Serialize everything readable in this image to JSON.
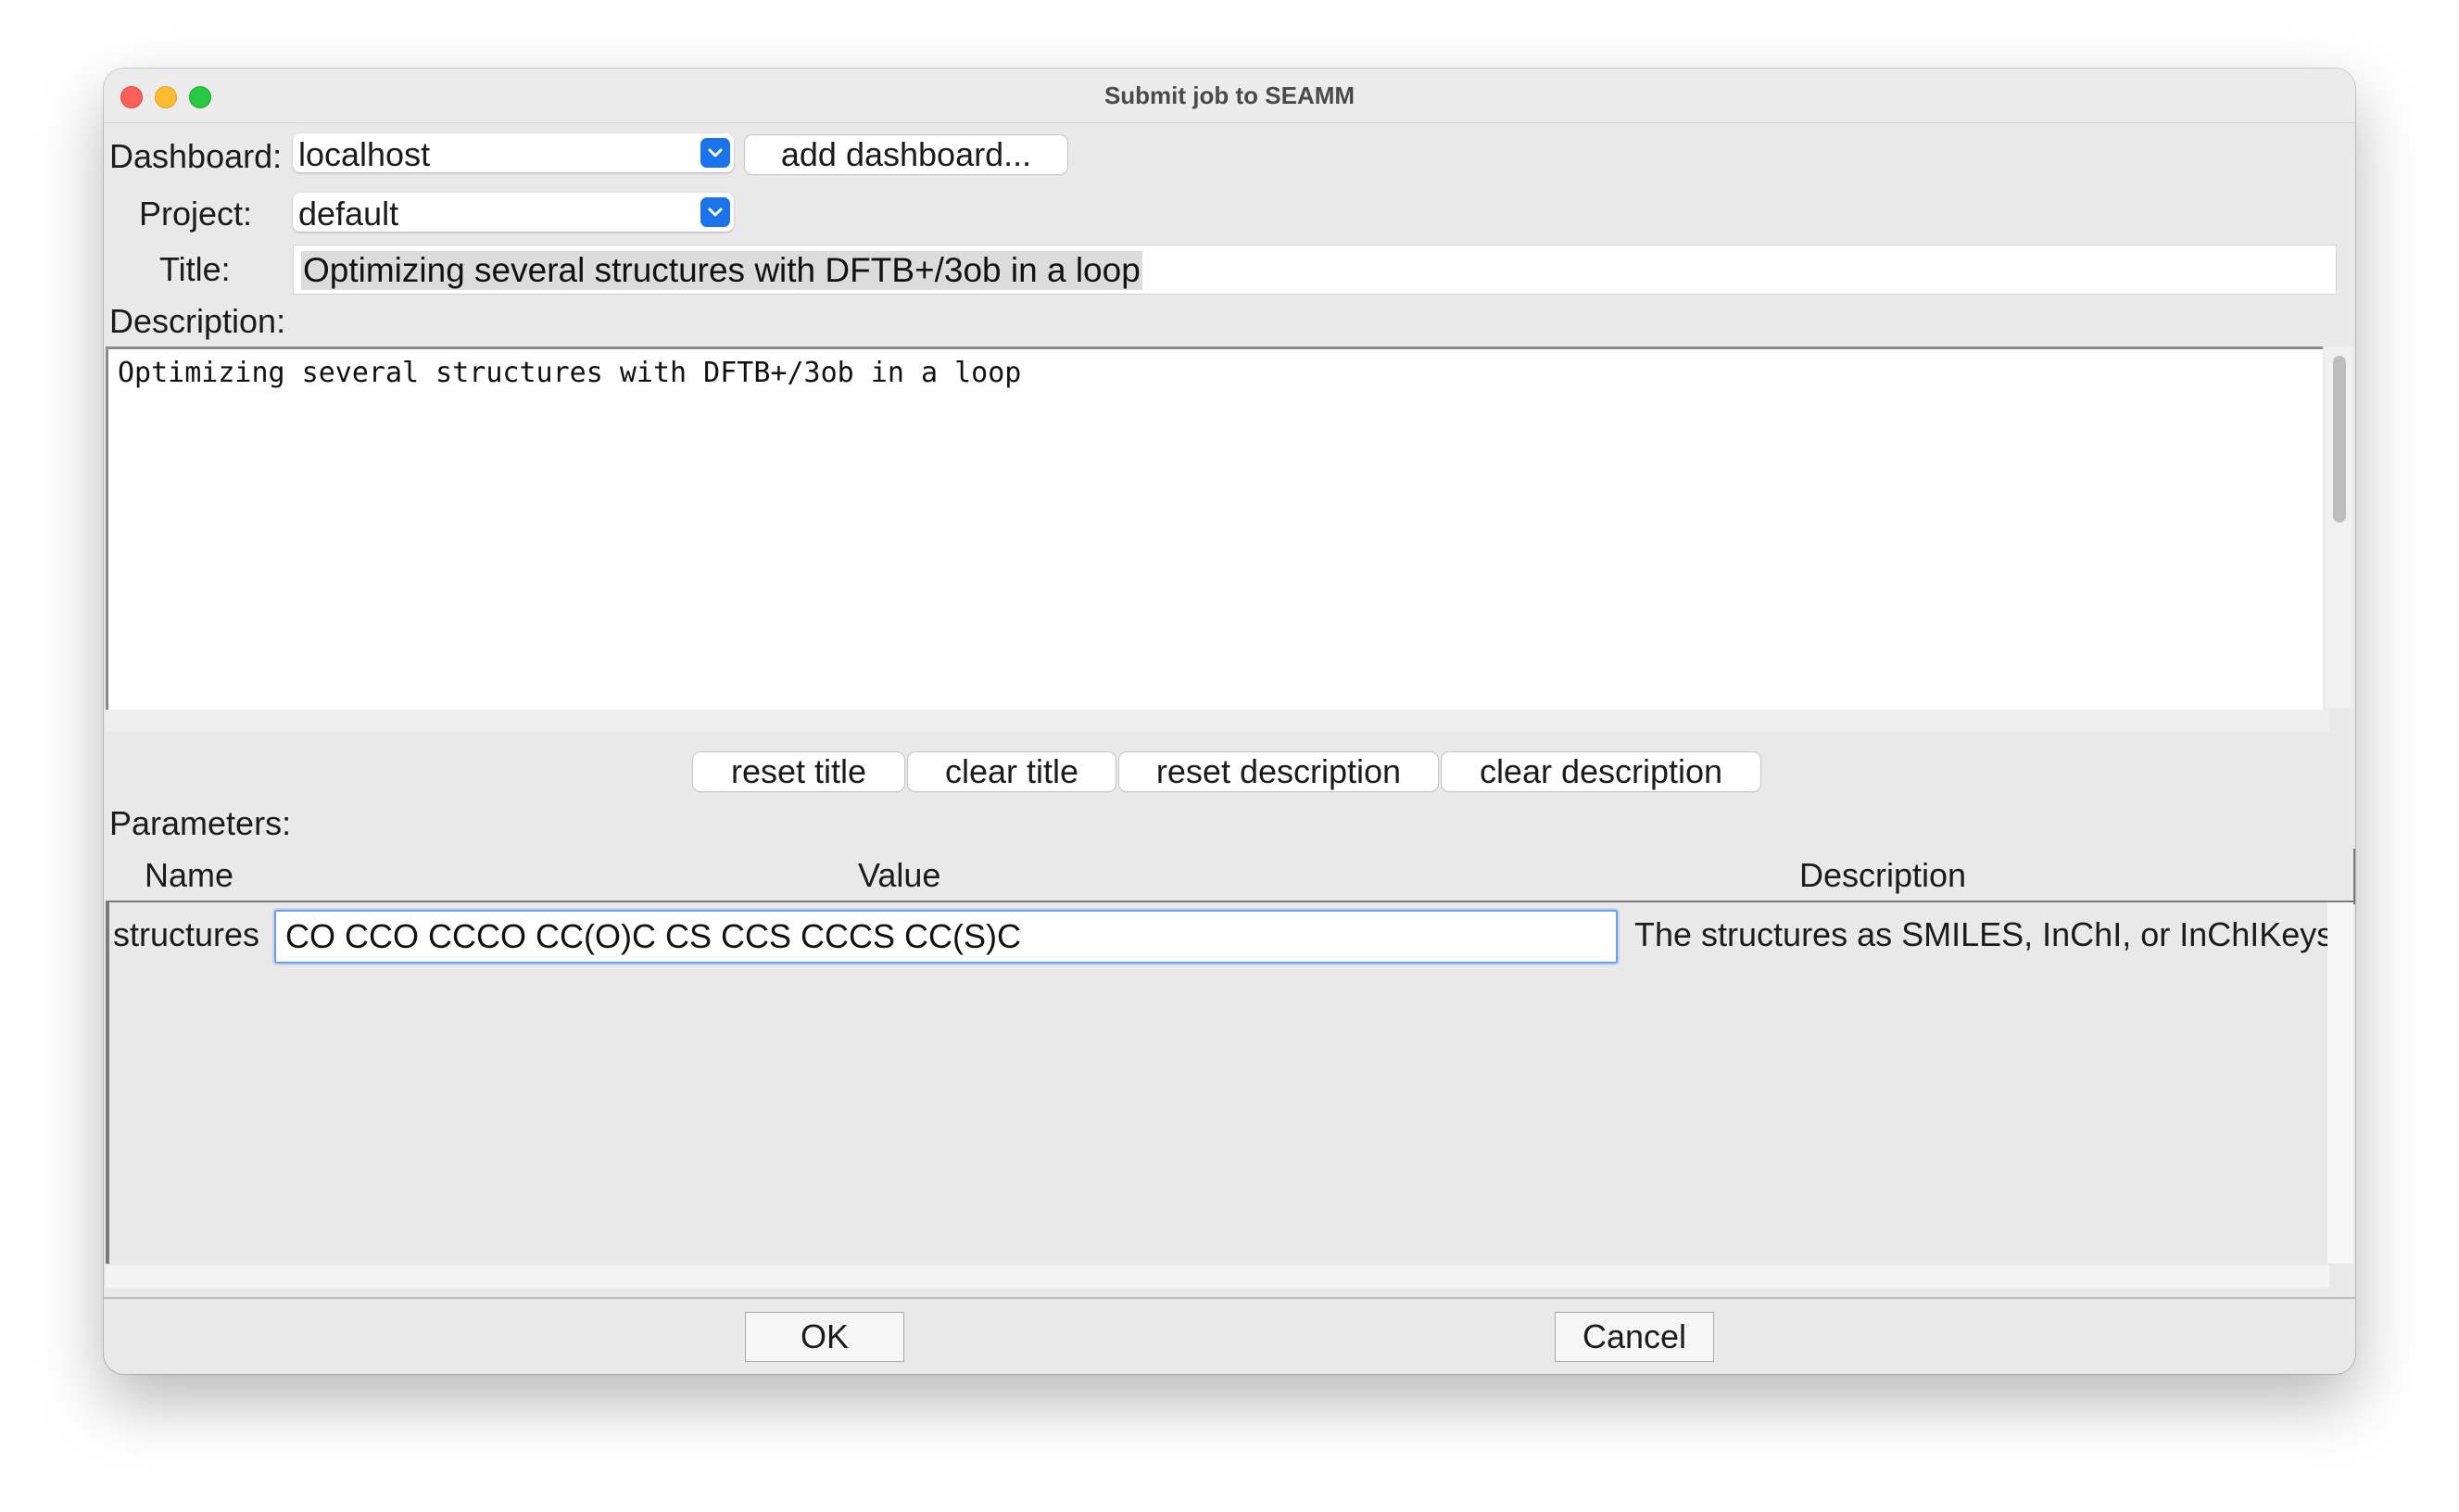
{
  "window": {
    "title": "Submit job to SEAMM"
  },
  "dashboard": {
    "label": "Dashboard:",
    "value": "localhost",
    "add_button": "add dashboard..."
  },
  "project": {
    "label": "Project:",
    "value": "default"
  },
  "title_field": {
    "label": "Title:",
    "value": "Optimizing several structures with DFTB+/3ob in a loop"
  },
  "description": {
    "label": "Description:",
    "text": "Optimizing several structures with DFTB+/3ob in a loop"
  },
  "actions": {
    "reset_title": "reset title",
    "clear_title": "clear title",
    "reset_description": "reset description",
    "clear_description": "clear description"
  },
  "parameters": {
    "label": "Parameters:",
    "columns": [
      "Name",
      "Value",
      "Description"
    ],
    "rows": [
      {
        "name": "structures",
        "value": "CO CCO CCCO CC(O)C CS CCS CCCS CC(S)C",
        "description": "The structures as SMILES, InChI, or InChIKeys"
      }
    ]
  },
  "footer": {
    "ok": "OK",
    "cancel": "Cancel"
  }
}
